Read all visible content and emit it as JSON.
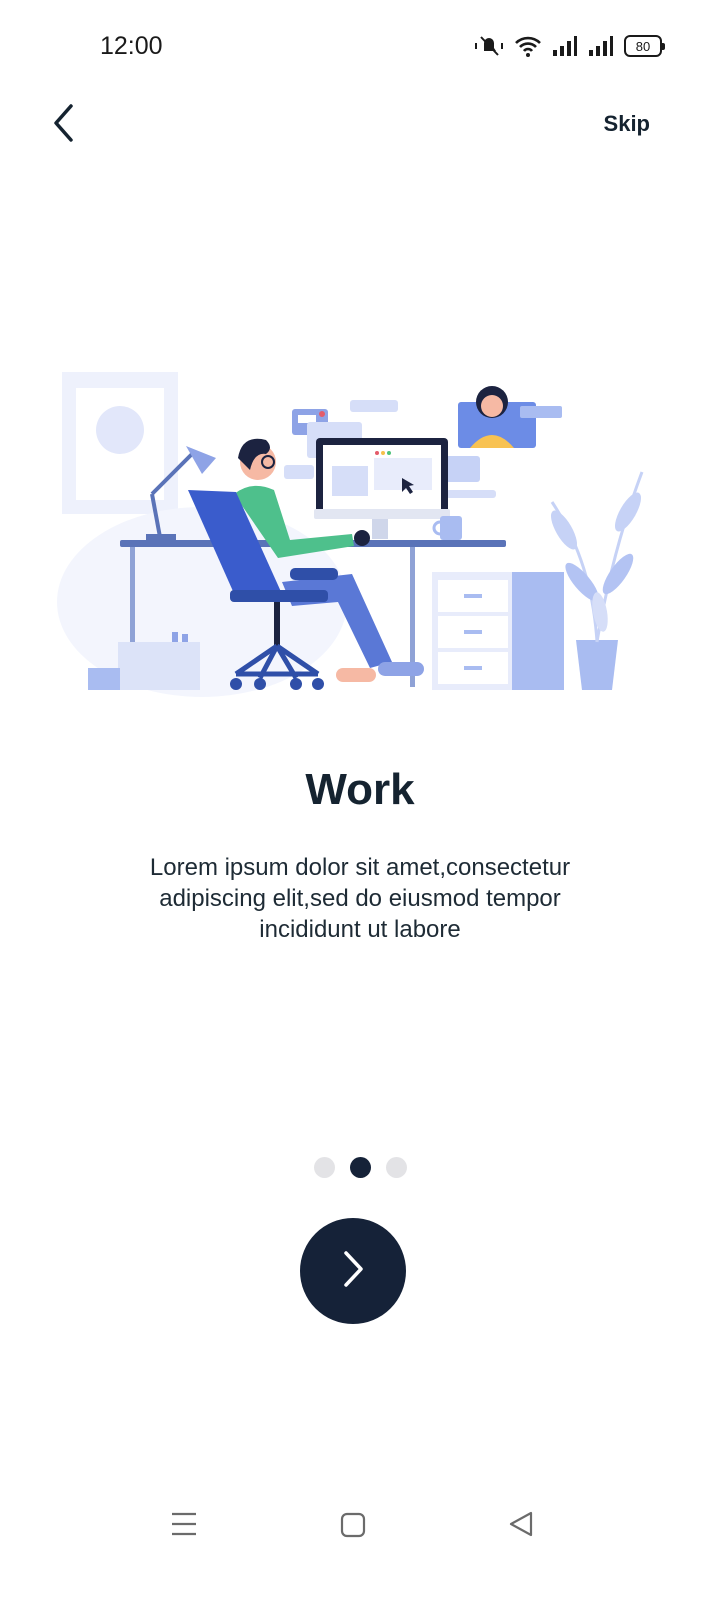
{
  "status_bar": {
    "time": "12:00",
    "battery_level": "80",
    "icons": [
      "mute-icon",
      "wifi-icon",
      "signal-icon",
      "signal-icon",
      "battery-icon"
    ]
  },
  "header": {
    "back_icon": "chevron-left-icon",
    "skip_label": "Skip"
  },
  "onboarding": {
    "illustration": "person-working-at-desk-illustration",
    "title": "Work",
    "description": "Lorem ipsum dolor sit amet,consectetur adipiscing elit,sed do eiusmod tempor incididunt ut labore",
    "page_count": 3,
    "active_page": 2,
    "next_icon": "chevron-right-icon"
  },
  "nav_bar": {
    "icons": [
      "menu-icon",
      "home-icon",
      "back-triangle-icon"
    ]
  },
  "colors": {
    "primary_dark": "#152238",
    "text": "#152330",
    "dot_inactive": "#e3e3e6",
    "illustration_blue": "#4a6fd6",
    "illustration_light": "#e8ecfb"
  }
}
